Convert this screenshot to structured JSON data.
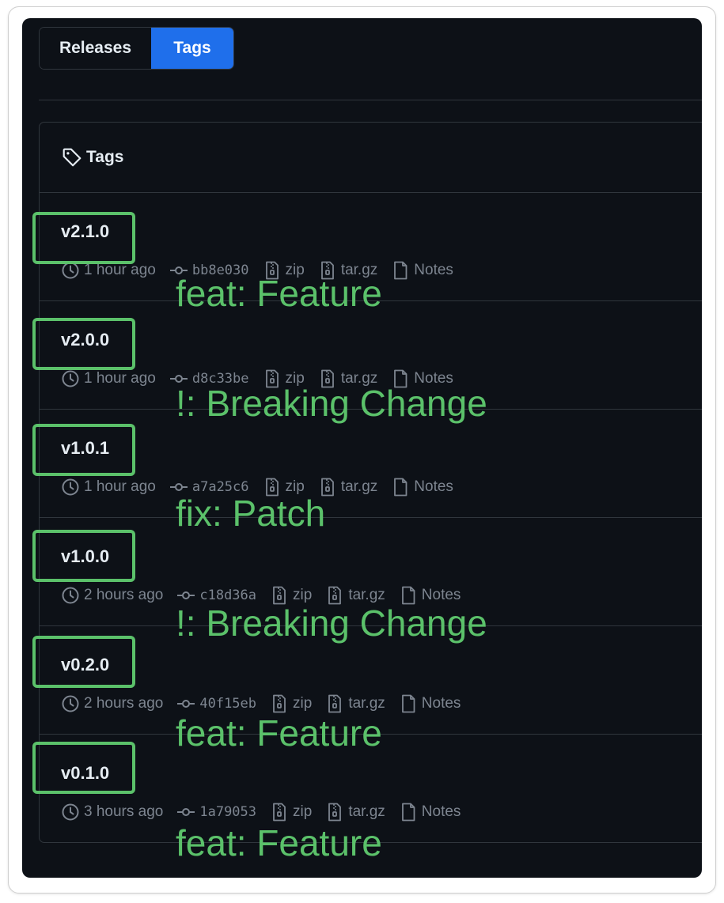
{
  "tabs": [
    {
      "label": "Releases",
      "active": false
    },
    {
      "label": "Tags",
      "active": true
    }
  ],
  "colors": {
    "accent": "#1f6feb",
    "highlight": "#5bc16a",
    "background": "#0d1117"
  },
  "box": {
    "title": "Tags",
    "icon": "tag-icon"
  },
  "tags": [
    {
      "name": "v2.1.0",
      "time": "1 hour ago",
      "sha": "bb8e030",
      "zip": "zip",
      "targz": "tar.gz",
      "notes": "Notes",
      "annotation": "feat: Feature"
    },
    {
      "name": "v2.0.0",
      "time": "1 hour ago",
      "sha": "d8c33be",
      "zip": "zip",
      "targz": "tar.gz",
      "notes": "Notes",
      "annotation": "!: Breaking Change"
    },
    {
      "name": "v1.0.1",
      "time": "1 hour ago",
      "sha": "a7a25c6",
      "zip": "zip",
      "targz": "tar.gz",
      "notes": "Notes",
      "annotation": "fix: Patch"
    },
    {
      "name": "v1.0.0",
      "time": "2 hours ago",
      "sha": "c18d36a",
      "zip": "zip",
      "targz": "tar.gz",
      "notes": "Notes",
      "annotation": "!: Breaking Change"
    },
    {
      "name": "v0.2.0",
      "time": "2 hours ago",
      "sha": "40f15eb",
      "zip": "zip",
      "targz": "tar.gz",
      "notes": "Notes",
      "annotation": "feat: Feature"
    },
    {
      "name": "v0.1.0",
      "time": "3 hours ago",
      "sha": "1a79053",
      "zip": "zip",
      "targz": "tar.gz",
      "notes": "Notes",
      "annotation": "feat: Feature"
    }
  ]
}
